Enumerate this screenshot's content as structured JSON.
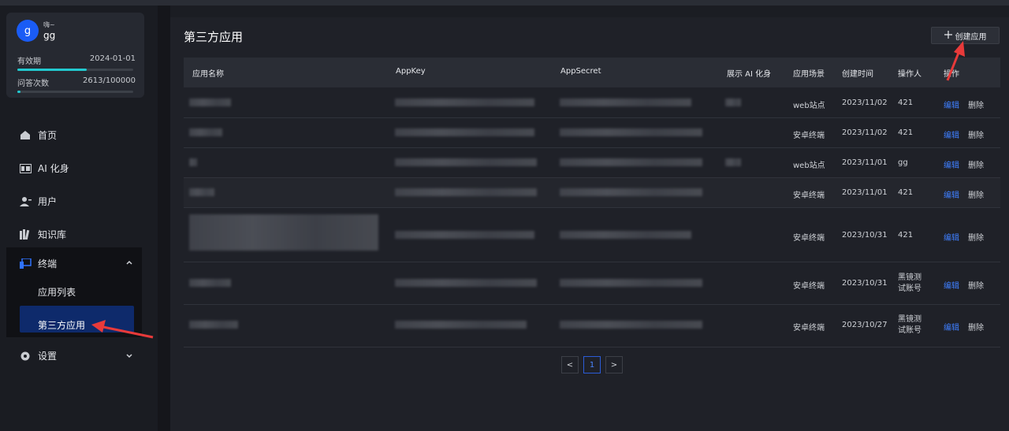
{
  "user": {
    "avatar_letter": "g",
    "small_name": "嗨~",
    "name": "gg",
    "validity_label": "有效期",
    "validity_value": "2024-01-01",
    "validity_progress": 0.6,
    "qa_label": "问答次数",
    "qa_value": "2613/100000",
    "qa_progress": 0.026
  },
  "nav": {
    "home": "首页",
    "ai": "AI 化身",
    "users": "用户",
    "kb": "知识库",
    "terminal": "终端",
    "app_list": "应用列表",
    "third_party": "第三方应用",
    "settings": "设置"
  },
  "page": {
    "title": "第三方应用",
    "create_button": "创建应用"
  },
  "table": {
    "headers": [
      "应用名称",
      "AppKey",
      "AppSecret",
      "展示 AI 化身",
      "应用场景",
      "创建时间",
      "操作人",
      "操作"
    ],
    "rows": [
      {
        "scene": "web站点",
        "date": "2023/11/02",
        "operator": "421",
        "edit": "编辑",
        "delete": "删除"
      },
      {
        "scene": "安卓终端",
        "date": "2023/11/02",
        "operator": "421",
        "edit": "编辑",
        "delete": "删除"
      },
      {
        "scene": "web站点",
        "date": "2023/11/01",
        "operator": "gg",
        "edit": "编辑",
        "delete": "删除"
      },
      {
        "scene": "安卓终端",
        "date": "2023/11/01",
        "operator": "421",
        "edit": "编辑",
        "delete": "删除"
      },
      {
        "scene": "安卓终端",
        "date": "2023/10/31",
        "operator": "421",
        "edit": "编辑",
        "delete": "删除"
      },
      {
        "scene": "安卓终端",
        "date": "2023/10/31",
        "operator": "黑镜测试账号",
        "edit": "编辑",
        "delete": "删除"
      },
      {
        "scene": "安卓终端",
        "date": "2023/10/27",
        "operator": "黑镜测试账号",
        "edit": "编辑",
        "delete": "删除"
      }
    ]
  },
  "pagination": {
    "prev": "<",
    "current": "1",
    "next": ">"
  },
  "colors": {
    "accent": "#3f7fff",
    "active_nav": "#0e2a6b",
    "progress": "#22c9cf",
    "annotation_arrow": "#e83a3a"
  }
}
